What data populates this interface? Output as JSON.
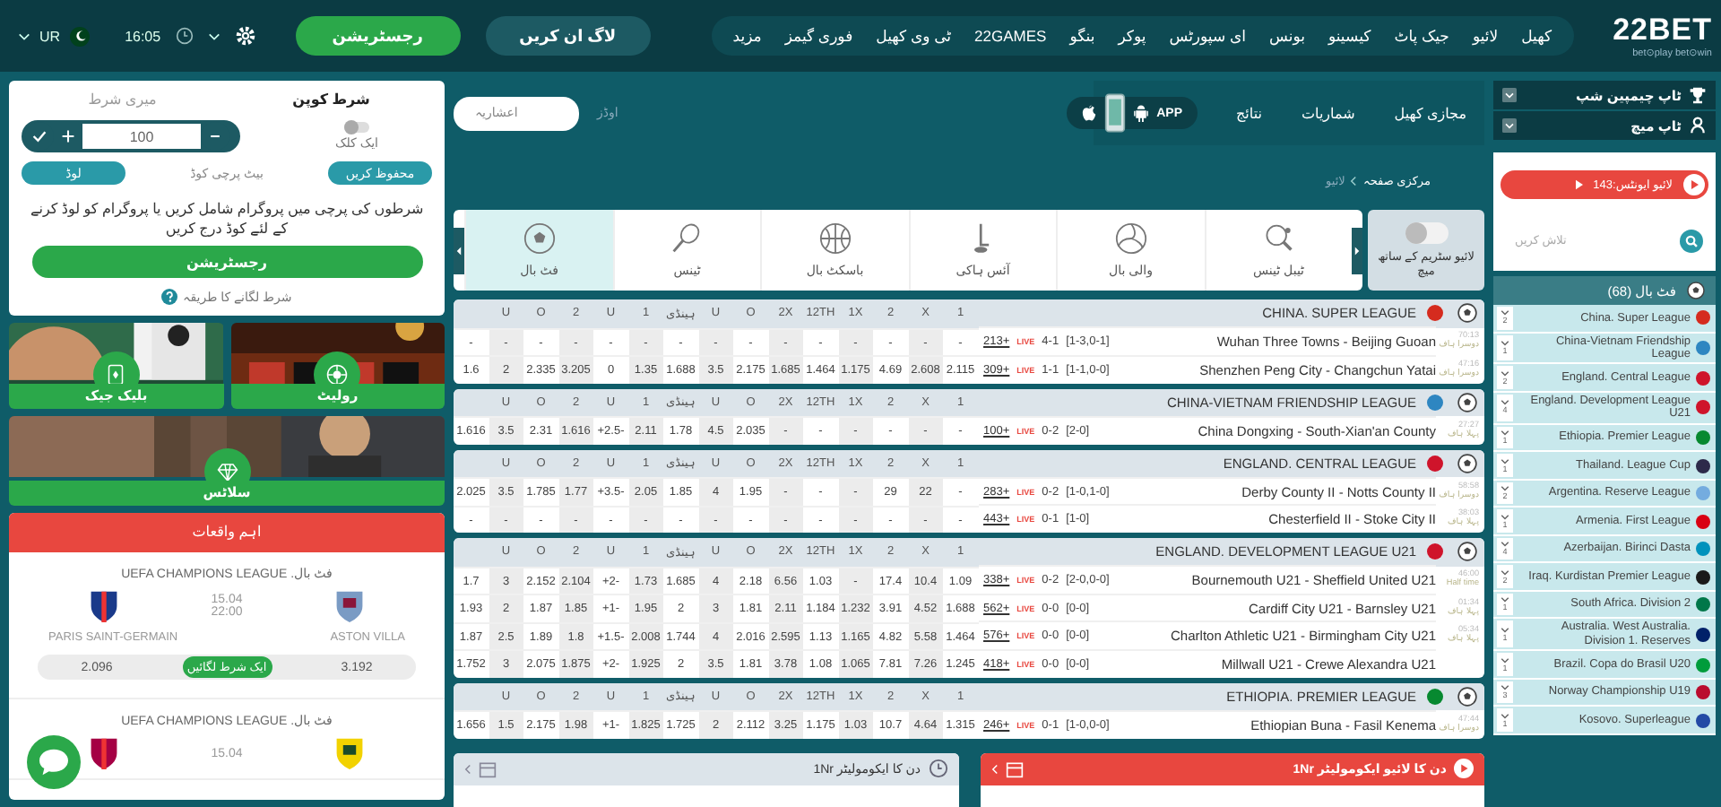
{
  "header": {
    "logo": "22BET",
    "tagline": "bet⊙play bet⊙win",
    "language": "UR",
    "time": "16:05",
    "register": "رجسٹریشن",
    "login": "لاگ ان کریں",
    "nav": [
      "کھیل",
      "لائیو",
      "جیک پاٹ",
      "کیسینو",
      "بونس",
      "ای سپورٹس",
      "پوکر",
      "بنگو",
      "22GAMES",
      "ٹی وی کھیل",
      "فوری گیمز",
      "مزید"
    ]
  },
  "subnav": {
    "items": [
      "مجازی کھیل",
      "شماریات",
      "نتائج"
    ],
    "app": "APP",
    "odds_label": "اوڈز",
    "odds_format": "اعشاریہ"
  },
  "breadcrumb": [
    "مرکزی صفحہ",
    "لائیو"
  ],
  "stream_filter": {
    "label": "لائیو سٹریم کے ساتھ میچ",
    "on": false
  },
  "sports": [
    {
      "label": "ٹیبل ٹینس",
      "kind": "table-tennis",
      "selected": false
    },
    {
      "label": "والی بال",
      "kind": "volleyball",
      "selected": false
    },
    {
      "label": "آئس ہاکی",
      "kind": "hockey",
      "selected": false
    },
    {
      "label": "باسکٹ بال",
      "kind": "basketball",
      "selected": false
    },
    {
      "label": "ٹینس",
      "kind": "tennis",
      "selected": false
    },
    {
      "label": "فٹ بال",
      "kind": "football",
      "selected": true
    }
  ],
  "leagues": [
    {
      "name": "CHINA. SUPER LEAGUE",
      "color": "#d52b1e",
      "columns": [
        "",
        "U",
        "O",
        "2",
        "U",
        "1",
        "ہینڈی",
        "U",
        "O",
        "2X",
        "12TH",
        "1X",
        "2",
        "X",
        "1"
      ],
      "matches": [
        {
          "time": "70:13",
          "period": "دوسرا ہاف",
          "teams": "Wuhan Three Towns - Beijing Guoan",
          "score": "4-1",
          "detail": "[1-3,0-1]",
          "markets": "213+",
          "badge": "LIVE",
          "odds": [
            "-",
            "-",
            "-",
            "-",
            "-",
            "-",
            "-",
            "-",
            "-",
            "-",
            "-",
            "-",
            "-",
            "-",
            "-"
          ]
        },
        {
          "time": "47:16",
          "period": "دوسرا ہاف",
          "teams": "Shenzhen Peng City - Changchun Yatai",
          "score": "1-1",
          "detail": "[1-1,0-0]",
          "markets": "309+",
          "badge": "LIVE",
          "odds": [
            "1.6",
            "2",
            "2.335",
            "3.205",
            "0",
            "1.35",
            "1.688",
            "3.5",
            "2.175",
            "1.685",
            "1.464",
            "1.175",
            "4.69",
            "2.608",
            "2.115"
          ]
        }
      ]
    },
    {
      "name": "CHINA-VIETNAM FRIENDSHIP LEAGUE",
      "color": "#2e86c1",
      "columns": [
        "",
        "U",
        "O",
        "2",
        "U",
        "1",
        "ہینڈی",
        "U",
        "O",
        "2X",
        "12TH",
        "1X",
        "2",
        "X",
        "1"
      ],
      "matches": [
        {
          "time": "27:27",
          "period": "پہلا ہاف",
          "teams": "China Dongxing - South-Xian'an County",
          "score": "0-2",
          "detail": "[2-0]",
          "markets": "100+",
          "badge": "LIVE",
          "odds": [
            "1.616",
            "3.5",
            "2.31",
            "1.616",
            "+2.5-",
            "2.11",
            "1.78",
            "4.5",
            "2.035",
            "-",
            "-",
            "-",
            "-",
            "-",
            "-"
          ]
        }
      ]
    },
    {
      "name": "ENGLAND. CENTRAL LEAGUE",
      "color": "#cf142b",
      "columns": [
        "",
        "U",
        "O",
        "2",
        "U",
        "1",
        "ہینڈی",
        "U",
        "O",
        "2X",
        "12TH",
        "1X",
        "2",
        "X",
        "1"
      ],
      "matches": [
        {
          "time": "58:58",
          "period": "دوسرا ہاف",
          "teams": "Derby County II - Notts County II",
          "score": "0-2",
          "detail": "[1-0,1-0]",
          "markets": "283+",
          "badge": "LIVE",
          "odds": [
            "2.025",
            "3.5",
            "1.785",
            "1.77",
            "+3.5-",
            "2.05",
            "1.85",
            "4",
            "1.95",
            "-",
            "-",
            "-",
            "29",
            "22",
            "-"
          ]
        },
        {
          "time": "38:03",
          "period": "پہلا ہاف",
          "teams": "Chesterfield II - Stoke City II",
          "score": "0-1",
          "detail": "[1-0]",
          "markets": "443+",
          "badge": "LIVE",
          "odds": [
            "-",
            "-",
            "-",
            "-",
            "-",
            "-",
            "-",
            "-",
            "-",
            "-",
            "-",
            "-",
            "-",
            "-",
            "-"
          ]
        }
      ]
    },
    {
      "name": "ENGLAND. DEVELOPMENT LEAGUE U21",
      "color": "#cf142b",
      "columns": [
        "",
        "U",
        "O",
        "2",
        "U",
        "1",
        "ہینڈی",
        "U",
        "O",
        "2X",
        "12TH",
        "1X",
        "2",
        "X",
        "1"
      ],
      "matches": [
        {
          "time": "46:00",
          "period": "Half time",
          "teams": "Bournemouth U21 - Sheffield United U21",
          "score": "0-2",
          "detail": "[2-0,0-0]",
          "markets": "338+",
          "badge": "LIVE",
          "odds": [
            "1.7",
            "3",
            "2.152",
            "2.104",
            "+2-",
            "1.73",
            "1.685",
            "4",
            "2.18",
            "6.56",
            "1.03",
            "-",
            "17.4",
            "10.4",
            "1.09"
          ]
        },
        {
          "time": "01:34",
          "period": "پہلا ہاف",
          "teams": "Cardiff City U21 - Barnsley U21",
          "score": "0-0",
          "detail": "[0-0]",
          "markets": "562+",
          "badge": "LIVE",
          "odds": [
            "1.93",
            "2",
            "1.87",
            "1.85",
            "+1-",
            "1.95",
            "2",
            "3",
            "1.81",
            "2.11",
            "1.184",
            "1.232",
            "3.91",
            "4.52",
            "1.688"
          ]
        },
        {
          "time": "05:34",
          "period": "پہلا ہاف",
          "teams": "Charlton Athletic U21 - Birmingham City U21",
          "score": "0-0",
          "detail": "[0-0]",
          "markets": "576+",
          "badge": "LIVE",
          "odds": [
            "1.87",
            "2.5",
            "1.89",
            "1.8",
            "+1.5-",
            "2.008",
            "1.744",
            "4",
            "2.016",
            "2.595",
            "1.13",
            "1.165",
            "4.82",
            "5.58",
            "1.464"
          ]
        },
        {
          "teams": "Millwall U21 - Crewe Alexandra U21",
          "score": "0-0",
          "detail": "[0-0]",
          "markets": "418+",
          "badge": "LIVE",
          "odds": [
            "1.752",
            "3",
            "2.075",
            "1.875",
            "+2-",
            "1.925",
            "2",
            "3.5",
            "1.81",
            "3.78",
            "1.08",
            "1.065",
            "7.81",
            "7.26",
            "1.245"
          ]
        }
      ]
    },
    {
      "name": "ETHIOPIA. PREMIER LEAGUE",
      "color": "#078930",
      "columns": [
        "",
        "U",
        "O",
        "2",
        "U",
        "1",
        "ہینڈی",
        "U",
        "O",
        "2X",
        "12TH",
        "1X",
        "2",
        "X",
        "1"
      ],
      "matches": [
        {
          "time": "47:44",
          "period": "دوسرا ہاف",
          "teams": "Ethiopian Buna - Fasil Kenema",
          "score": "0-1",
          "detail": "[1-0,0-0]",
          "markets": "246+",
          "badge": "LIVE",
          "odds": [
            "1.656",
            "1.5",
            "2.175",
            "1.98",
            "+1-",
            "1.825",
            "1.725",
            "2",
            "2.112",
            "3.25",
            "1.175",
            "1.03",
            "10.7",
            "4.64",
            "1.315"
          ]
        }
      ]
    }
  ],
  "accumulators": [
    {
      "title": "دن کا لائیو ایکومولیٹر 1Nr",
      "live": true
    },
    {
      "title": "دن کا ایکومولیٹر 1Nr",
      "live": false
    }
  ],
  "bet_slip": {
    "tabs": [
      {
        "label": "شرط کوپن",
        "selected": true
      },
      {
        "label": "میری شرط",
        "selected": false
      }
    ],
    "one_click": {
      "label": "ایک کلک",
      "on": false
    },
    "stake": "100",
    "save": "محفوظ کریں",
    "code_label": "بیٹ پرچی کوڈ",
    "load": "لوڈ",
    "note": "شرطوں کی پرچی میں پروگرام شامل کریں یا پروگرام کو لوڈ کرنے کے لئے کوڈ درج کریں",
    "register": "رجسٹریشن",
    "help": "شرط لگانے کا طریقہ"
  },
  "casino": [
    {
      "label": "بلیک جیک",
      "kind": "blackjack"
    },
    {
      "label": "رولیٹ",
      "kind": "roulette"
    },
    {
      "label": "سلاٹس",
      "kind": "slots"
    }
  ],
  "top_events": {
    "title": "اہم واقعات",
    "events": [
      {
        "league": "فٹ بال. UEFA CHAMPIONS LEAGUE",
        "date": "15.04",
        "time": "22:00",
        "home": "ASTON VILLA",
        "away": "PARIS SAINT-GERMAIN",
        "home_odds": "3.192",
        "away_odds": "2.096",
        "bet": "ایک شرط لگائیں"
      },
      {
        "league": "فٹ بال. UEFA CHAMPIONS LEAGUE",
        "date": "15.04"
      }
    ]
  },
  "sidebar": {
    "top": [
      "ٹاپ چیمپین شپ",
      "ٹاپ میچ"
    ],
    "live_button": "لائیو ایونٹس:143",
    "search_placeholder": "تلاش کریں",
    "sport": "فٹ بال (68)",
    "leagues": [
      {
        "name": "China. Super League",
        "count": "2",
        "color": "#d52b1e"
      },
      {
        "name": "China-Vietnam Friendship League",
        "count": "1",
        "color": "#2e86c1"
      },
      {
        "name": "England. Central League",
        "count": "2",
        "color": "#cf142b"
      },
      {
        "name": "England. Development League U21",
        "count": "4",
        "color": "#cf142b"
      },
      {
        "name": "Ethiopia. Premier League",
        "count": "1",
        "color": "#078930"
      },
      {
        "name": "Thailand. League Cup",
        "count": "1",
        "color": "#2d2a4a"
      },
      {
        "name": "Argentina. Reserve League",
        "count": "2",
        "color": "#74acdf"
      },
      {
        "name": "Armenia. First League",
        "count": "1",
        "color": "#d90012"
      },
      {
        "name": "Azerbaijan. Birinci Dasta",
        "count": "4",
        "color": "#0092bc"
      },
      {
        "name": "Iraq. Kurdistan Premier League",
        "count": "2",
        "color": "#1a1a1a"
      },
      {
        "name": "South Africa. Division 2",
        "count": "1",
        "color": "#007749"
      },
      {
        "name": "Australia. West Australia. Division 1. Reserves",
        "count": "1",
        "color": "#012169"
      },
      {
        "name": "Brazil. Copa do Brasil U20",
        "count": "1",
        "color": "#009c3b"
      },
      {
        "name": "Norway Championship U19",
        "count": "3",
        "color": "#ba0c2f"
      },
      {
        "name": "Kosovo. Superleague",
        "count": "1",
        "color": "#244aa5"
      }
    ]
  }
}
